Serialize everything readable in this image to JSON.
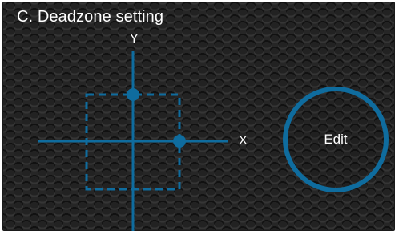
{
  "panel": {
    "title": "C. Deadzone setting"
  },
  "axes": {
    "x_label": "X",
    "y_label": "Y"
  },
  "edit_button": {
    "label": "Edit"
  },
  "colors": {
    "accent": "#0f6c9e",
    "background": "#262626",
    "text": "#ffffff"
  }
}
